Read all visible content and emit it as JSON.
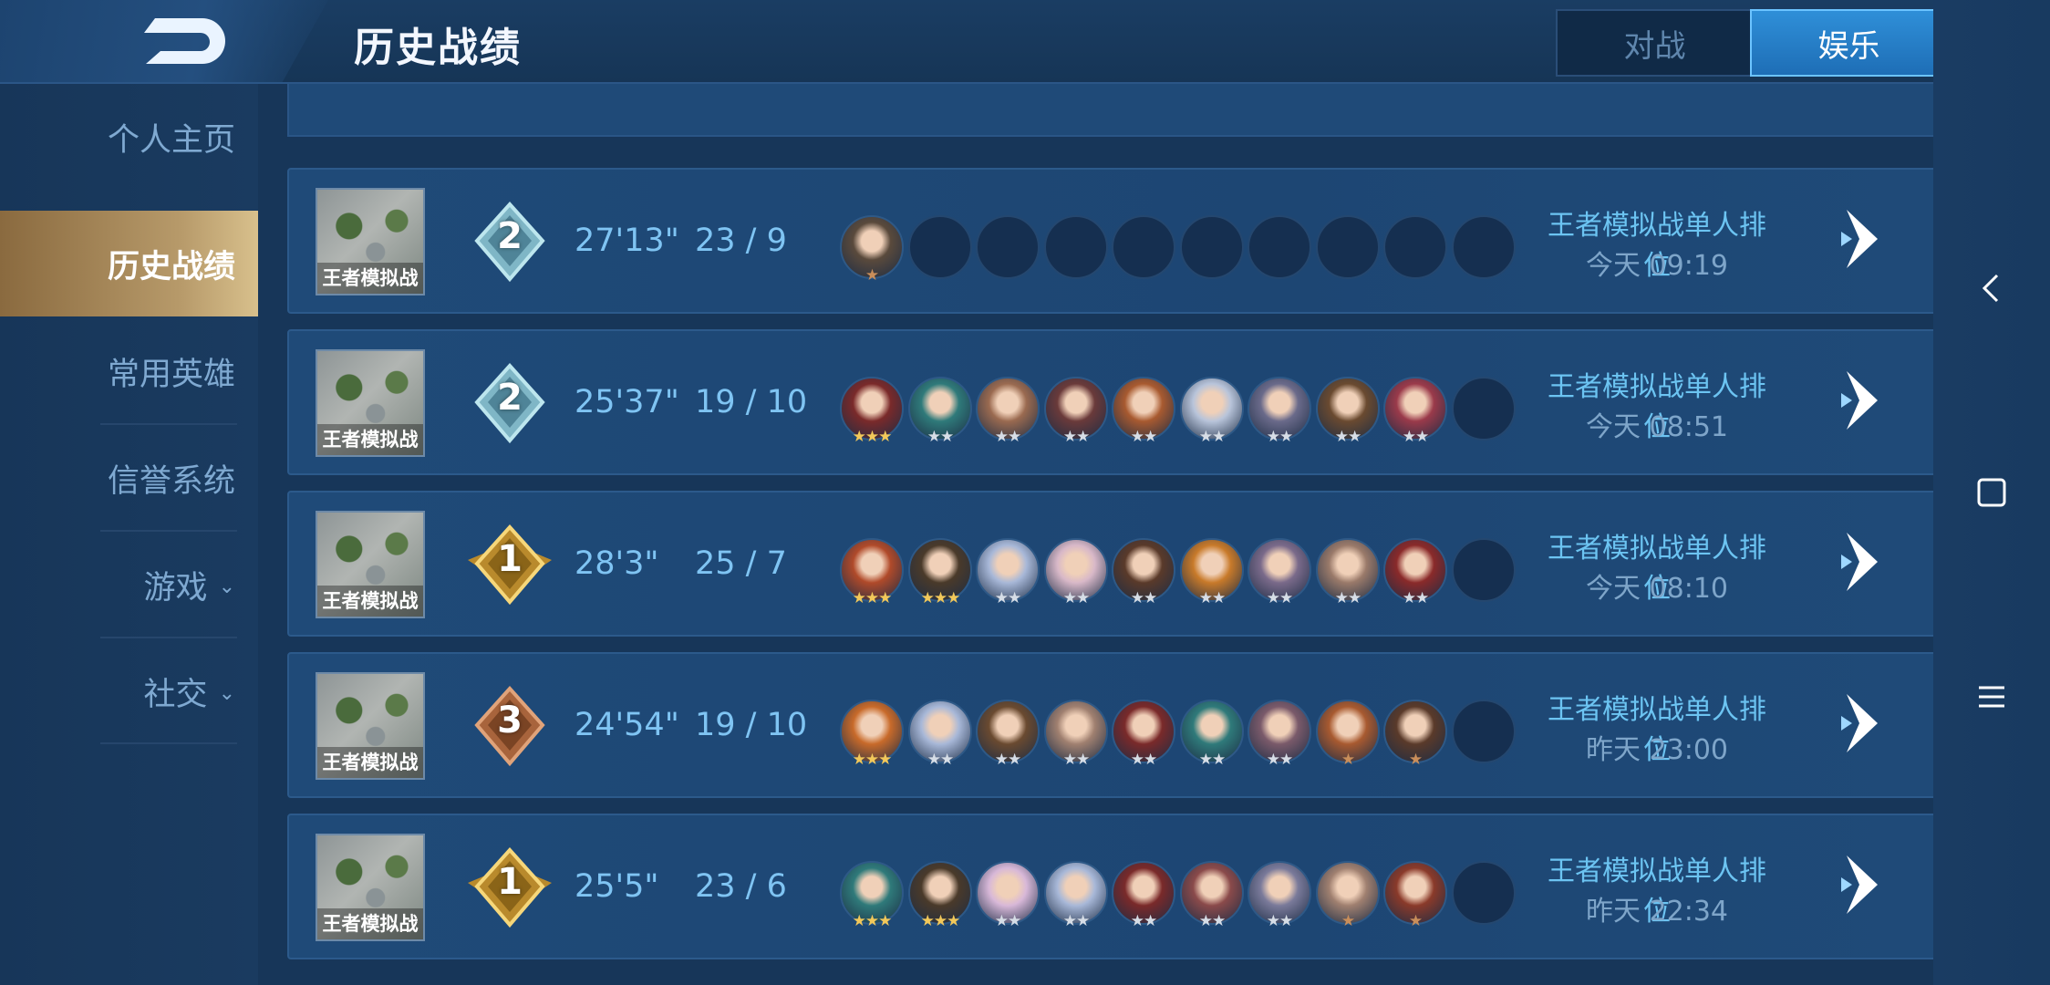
{
  "header": {
    "title": "历史战绩"
  },
  "mode_tabs": [
    {
      "label": "对战",
      "active": false
    },
    {
      "label": "娱乐",
      "active": true
    }
  ],
  "sidebar": {
    "items": [
      {
        "label": "个人主页",
        "active": false,
        "has_submenu": false
      },
      {
        "label": "历史战绩",
        "active": true,
        "has_submenu": false
      },
      {
        "label": "常用英雄",
        "active": false,
        "has_submenu": false
      },
      {
        "label": "信誉系统",
        "active": false,
        "has_submenu": false
      },
      {
        "label": "游戏",
        "active": false,
        "has_submenu": true
      },
      {
        "label": "社交",
        "active": false,
        "has_submenu": true
      }
    ]
  },
  "matches": [
    {
      "mode_label": "王者模拟战",
      "rank": "2",
      "rank_tier": "silver",
      "duration": "27'13\"",
      "kd": "23 / 9",
      "heroes": [
        {
          "stars": 1,
          "color": "#5a4a3c"
        },
        {
          "stars": 0,
          "color": ""
        },
        {
          "stars": 0,
          "color": ""
        },
        {
          "stars": 0,
          "color": ""
        },
        {
          "stars": 0,
          "color": ""
        },
        {
          "stars": 0,
          "color": ""
        },
        {
          "stars": 0,
          "color": ""
        },
        {
          "stars": 0,
          "color": ""
        },
        {
          "stars": 0,
          "color": ""
        },
        {
          "stars": 0,
          "color": ""
        }
      ],
      "match_type": "王者模拟战单人排位",
      "time": "今天 09:19"
    },
    {
      "mode_label": "王者模拟战",
      "rank": "2",
      "rank_tier": "silver",
      "duration": "25'37\"",
      "kd": "19 / 10",
      "heroes": [
        {
          "stars": 3,
          "color": "#7a2a2a"
        },
        {
          "stars": 2,
          "color": "#2f7a7a"
        },
        {
          "stars": 2,
          "color": "#9a6a50"
        },
        {
          "stars": 2,
          "color": "#6a3a3a"
        },
        {
          "stars": 2,
          "color": "#a85a30"
        },
        {
          "stars": 2,
          "color": "#b8c4da"
        },
        {
          "stars": 2,
          "color": "#6a6a8a"
        },
        {
          "stars": 2,
          "color": "#6a4a30"
        },
        {
          "stars": 2,
          "color": "#9a3a4a"
        },
        {
          "stars": 0,
          "color": ""
        }
      ],
      "match_type": "王者模拟战单人排位",
      "time": "今天 08:51"
    },
    {
      "mode_label": "王者模拟战",
      "rank": "1",
      "rank_tier": "gold",
      "duration": "28'3\"",
      "kd": "25 / 7",
      "heroes": [
        {
          "stars": 3,
          "color": "#b04a2a"
        },
        {
          "stars": 3,
          "color": "#4a3a2a"
        },
        {
          "stars": 2,
          "color": "#a8b8d8"
        },
        {
          "stars": 2,
          "color": "#d8b8c8"
        },
        {
          "stars": 2,
          "color": "#5a3a2a"
        },
        {
          "stars": 2,
          "color": "#c87a2a"
        },
        {
          "stars": 2,
          "color": "#7a6a8a"
        },
        {
          "stars": 2,
          "color": "#9a7a6a"
        },
        {
          "stars": 2,
          "color": "#8a2a2a"
        },
        {
          "stars": 0,
          "color": ""
        }
      ],
      "match_type": "王者模拟战单人排位",
      "time": "今天 08:10"
    },
    {
      "mode_label": "王者模拟战",
      "rank": "3",
      "rank_tier": "bronze",
      "duration": "24'54\"",
      "kd": "19 / 10",
      "heroes": [
        {
          "stars": 3,
          "color": "#c86a2a"
        },
        {
          "stars": 2,
          "color": "#a8b8d8"
        },
        {
          "stars": 2,
          "color": "#6a4a30"
        },
        {
          "stars": 2,
          "color": "#a08070"
        },
        {
          "stars": 2,
          "color": "#7a2a2a"
        },
        {
          "stars": 2,
          "color": "#2f7a7a"
        },
        {
          "stars": 2,
          "color": "#7a5a6a"
        },
        {
          "stars": 1,
          "color": "#a85a30"
        },
        {
          "stars": 1,
          "color": "#5a3a2a"
        },
        {
          "stars": 0,
          "color": ""
        }
      ],
      "match_type": "王者模拟战单人排位",
      "time": "昨天 23:00"
    },
    {
      "mode_label": "王者模拟战",
      "rank": "1",
      "rank_tier": "gold",
      "duration": "25'5\"",
      "kd": "23 / 6",
      "heroes": [
        {
          "stars": 3,
          "color": "#2f7a7a"
        },
        {
          "stars": 3,
          "color": "#4a3a2a"
        },
        {
          "stars": 2,
          "color": "#d8b8d8"
        },
        {
          "stars": 2,
          "color": "#a8b8d8"
        },
        {
          "stars": 2,
          "color": "#7a2a2a"
        },
        {
          "stars": 2,
          "color": "#8a4a4a"
        },
        {
          "stars": 2,
          "color": "#7a7a9a"
        },
        {
          "stars": 1,
          "color": "#a08070"
        },
        {
          "stars": 1,
          "color": "#8a3a2a"
        },
        {
          "stars": 0,
          "color": ""
        }
      ],
      "match_type": "王者模拟战单人排位",
      "time": "昨天 22:34"
    }
  ],
  "icons": {
    "back": "back-arrow-icon",
    "detail": "chevron-right-icon",
    "android_back": "android-back-icon",
    "android_home": "android-home-icon",
    "android_menu": "android-menu-icon"
  },
  "colors": {
    "background": "#173659",
    "accent_text": "#7fc4f3",
    "active_nav_gold": "#b79a6a",
    "active_tab_blue": "#2f8fd8"
  }
}
